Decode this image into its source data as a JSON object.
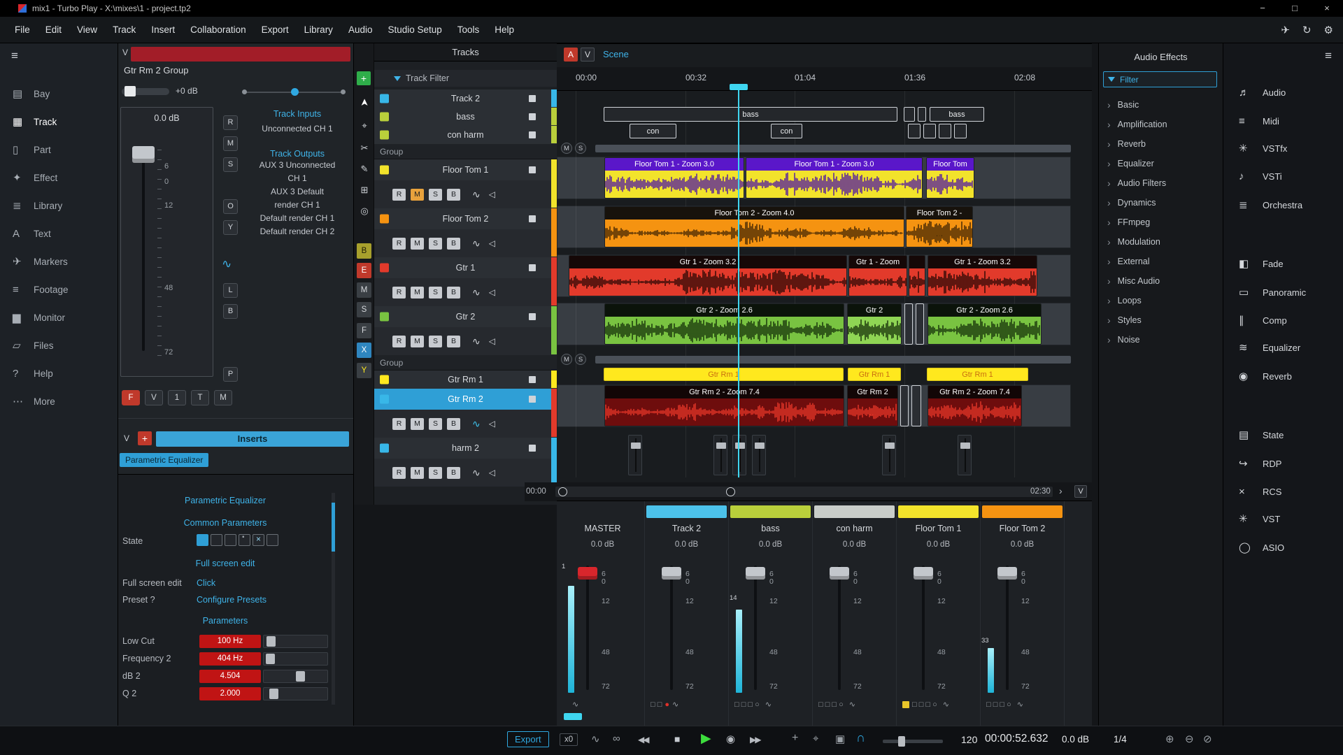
{
  "titlebar": {
    "title": "mix1 - Turbo Play - X:\\mixes\\1 - project.tp2",
    "minimize": "−",
    "maximize": "□",
    "close": "×"
  },
  "menubar": {
    "items": [
      "File",
      "Edit",
      "View",
      "Track",
      "Insert",
      "Collaboration",
      "Export",
      "Library",
      "Audio",
      "Studio Setup",
      "Tools",
      "Help"
    ],
    "right_icons": [
      {
        "glyph": "✈"
      },
      {
        "glyph": "↻"
      },
      {
        "glyph": "⚙"
      }
    ]
  },
  "nav": {
    "items": [
      {
        "label": "Bay",
        "glyph": "▤"
      },
      {
        "label": "Track",
        "glyph": "▦",
        "cls": "active"
      },
      {
        "label": "Part",
        "glyph": "▯"
      },
      {
        "label": "Effect",
        "glyph": "✦"
      },
      {
        "label": "Library",
        "glyph": "≣"
      },
      {
        "label": "Text",
        "glyph": "A"
      },
      {
        "label": "Markers",
        "glyph": "✈"
      },
      {
        "label": "Footage",
        "glyph": "≡"
      },
      {
        "label": "Monitor",
        "glyph": "▆"
      },
      {
        "label": "Files",
        "glyph": "▱"
      },
      {
        "label": "Help",
        "glyph": "?"
      },
      {
        "label": "More",
        "glyph": "⋯"
      }
    ]
  },
  "channel": {
    "header_button": "V",
    "group_label": "Gtr Rm 2 Group",
    "volume_label": "+0 dB",
    "fader_db": "0.0 dB",
    "fader_scale": [
      {
        "label": "6",
        "style": "top:78px"
      },
      {
        "label": "0",
        "style": "top:100px"
      },
      {
        "label": "12",
        "style": "top:134px"
      },
      {
        "label": "48",
        "style": "top:252px"
      },
      {
        "label": "72",
        "style": "top:344px"
      }
    ],
    "side_buttons": [
      {
        "label": "R",
        "style": "top:103px"
      },
      {
        "label": "M",
        "style": "top:133px"
      },
      {
        "label": "S",
        "style": "top:163px"
      },
      {
        "label": "O",
        "style": "top:223px"
      },
      {
        "label": "Y",
        "style": "top:253px"
      },
      {
        "label": "L",
        "style": "top:343px"
      },
      {
        "label": "B",
        "style": "top:373px"
      },
      {
        "label": "P",
        "style": "top:463px"
      }
    ],
    "lfo_glyph": "∿",
    "inputs_title": "Track Inputs",
    "inputs_value": "Unconnected CH 1",
    "outputs_title": "Track Outputs",
    "outputs_lines": [
      "AUX 3 Unconnected",
      "CH 1",
      "AUX 3 Default",
      "render CH 1",
      "Default render CH 1",
      "Default render CH 2"
    ],
    "bottom_buttons": [
      {
        "label": "F",
        "style": "background:#c0392b;border-color:#c0392b;color:#fff"
      },
      {
        "label": "V"
      },
      {
        "label": "1"
      },
      {
        "label": "T"
      },
      {
        "label": "M"
      }
    ],
    "inserts_v": "V",
    "inserts_add": "+",
    "inserts_label": "Inserts",
    "insert_chip": "Parametric Equalizer"
  },
  "eq": {
    "title": "Parametric Equalizer",
    "common_header": "Common Parameters",
    "state_label": "State",
    "state_boxes": [
      {
        "cls": "filled"
      },
      {
        "cls": "empty"
      },
      {
        "cls": "empty"
      },
      {
        "cls": "dot"
      },
      {
        "cls": "cross"
      },
      {
        "cls": "empty"
      }
    ],
    "fullscreen_link": "Full screen edit",
    "fullscreen_label": "Full screen edit",
    "fullscreen_value": "Click",
    "preset_label": "Preset ?",
    "preset_value": "Configure Presets",
    "params_header": "Parameters",
    "params": [
      {
        "label": "Low Cut",
        "value": "100 Hz",
        "handle_style": "left:4px"
      },
      {
        "label": "Frequency 2",
        "value": "404 Hz",
        "handle_style": "left:3px"
      },
      {
        "label": "dB 2",
        "value": "4.504",
        "handle_style": "left:46px"
      },
      {
        "label": "Q 2",
        "value": "2.000",
        "handle_style": "left:8px"
      }
    ]
  },
  "tools": {
    "add_label": "+",
    "icons": [
      {
        "glyph": "➤",
        "style": "top:76px",
        "cls": "pointer"
      },
      {
        "glyph": "⌖",
        "style": "top:110px"
      },
      {
        "glyph": "✂",
        "style": "top:142px"
      },
      {
        "glyph": "✎",
        "style": "top:172px"
      },
      {
        "glyph": "⊞",
        "style": "top:202px"
      },
      {
        "glyph": "◎",
        "style": "top:232px"
      }
    ],
    "letters": [
      {
        "label": "B",
        "style": "top:286px;background:#a8a02c;color:#1d1b08"
      },
      {
        "label": "E",
        "style": "top:314px;background:#c0392b;color:#fff"
      },
      {
        "label": "M",
        "style": "top:342px"
      },
      {
        "label": "S",
        "style": "top:370px"
      },
      {
        "label": "F",
        "style": "top:400px"
      },
      {
        "label": "X",
        "style": "top:428px;background:#2f86c0;color:#fff"
      },
      {
        "label": "Y",
        "style": "top:457px;color:#ffe81e"
      }
    ]
  },
  "tracks": {
    "header": "Tracks",
    "filter_label": "Track Filter",
    "row_buttons": [
      "R",
      "M",
      "S",
      "B"
    ],
    "wave_glyph": "∿",
    "speaker_glyph": "◁",
    "rows": [
      {
        "cls": "simple",
        "name": "Track 2",
        "swatch": "background:#38b7e8",
        "bar": "background:#38b7e8"
      },
      {
        "cls": "simple",
        "name": "bass",
        "swatch": "background:#b9cf3b",
        "bar": "background:#b9cf3b"
      },
      {
        "cls": "simple",
        "name": "con harm",
        "swatch": "background:#b9cf3b",
        "bar": "background:#b9cf3b"
      },
      {
        "cls": "group",
        "name": "Group"
      },
      {
        "cls": "full",
        "name": "Floor Tom 1",
        "swatch": "background:#f2e32b",
        "bar": "background:#f2e32b",
        "m_style": "background:#e8a23c;color:#222"
      },
      {
        "cls": "full",
        "name": "Floor Tom 2",
        "swatch": "background:#f59311",
        "bar": "background:#f59311"
      },
      {
        "cls": "full",
        "name": "Gtr 1",
        "swatch": "background:#e23a2b",
        "bar": "background:#e23a2b"
      },
      {
        "cls": "full",
        "name": "Gtr 2",
        "swatch": "background:#79c341",
        "bar": "background:#79c341"
      },
      {
        "cls": "group",
        "name": "Group"
      },
      {
        "cls": "simple",
        "name": "Gtr Rm 1",
        "swatch": "background:#ffe81e",
        "bar": "background:#ffe81e"
      },
      {
        "cls": "full sel",
        "name": "Gtr Rm 2",
        "swatch": "background:#38b7e8",
        "bar": "background:#e23a2b",
        "wave_style": "color:#3fc6f0"
      },
      {
        "cls": "full",
        "name": "harm 2",
        "swatch": "background:#38b7e8",
        "bar": "background:#38b7e8"
      }
    ]
  },
  "timeline": {
    "btn_a": "A",
    "btn_v": "V",
    "scene_label": "Scene",
    "ruler": [
      {
        "label": "00:00",
        "style": "left:27px"
      },
      {
        "label": "00:32",
        "style": "left:184px"
      },
      {
        "label": "01:04",
        "style": "left:340px"
      },
      {
        "label": "01:36",
        "style": "left:497px"
      },
      {
        "label": "02:08",
        "style": "left:654px"
      }
    ],
    "group_ms": [
      "M",
      "S"
    ],
    "row_bass": [
      {
        "label": "bass",
        "style": "left:67px;width:420px"
      },
      {
        "label": "",
        "style": "left:496px;width:16px"
      },
      {
        "label": "",
        "style": "left:516px;width:12px"
      },
      {
        "label": "bass",
        "style": "left:533px;width:78px"
      }
    ],
    "row_con": [
      {
        "label": "con",
        "style": "left:104px;width:67px"
      },
      {
        "label": "con",
        "style": "left:306px;width:45px"
      },
      {
        "label": "",
        "style": "left:502px;width:18px"
      },
      {
        "label": "",
        "style": "left:524px;width:18px"
      },
      {
        "label": "",
        "style": "left:546px;width:18px"
      },
      {
        "label": "",
        "style": "left:568px;width:18px"
      }
    ],
    "row_ft1": [
      {
        "label": "Floor Tom 1 - Zoom 3.0",
        "style": "left:67px;width:200px",
        "head_style": "background:#5a17c9",
        "body_style": "background:#f2e32b;color:#4b11a8"
      },
      {
        "label": "Floor Tom 1 - Zoom 3.0",
        "style": "left:269px;width:253px",
        "head_style": "background:#5a17c9",
        "body_style": "background:#f2e32b;color:#4b11a8"
      },
      {
        "label": "Floor Tom",
        "style": "left:527px;width:69px",
        "head_style": "background:#5a17c9",
        "body_style": "background:#f2e32b;color:#4b11a8",
        "dots": "..."
      }
    ],
    "row_ft2": [
      {
        "label": "Floor Tom 2 - Zoom 4.0",
        "style": "left:67px;width:429px",
        "head_style": "background:#17120c",
        "body_style": "background:#f59311;color:#3c2203"
      },
      {
        "label": "Floor Tom 2 -",
        "style": "left:498px;width:96px",
        "head_style": "background:#17120c",
        "body_style": "background:#f59311;color:#3c2203",
        "dots": "..."
      }
    ],
    "row_g1": [
      {
        "label": "Gtr 1 - Zoom 3.2",
        "style": "left:16px;width:398px",
        "head_style": "background:#150807",
        "body_style": "background:#e23a2b;color:#270704"
      },
      {
        "label": "Gtr 1 - Zoom",
        "style": "left:416px;width:84px",
        "head_style": "background:#150807",
        "body_style": "background:#e23a2b;color:#270704"
      },
      {
        "label": "",
        "style": "left:502px;width:24px",
        "head_style": "background:#150807",
        "body_style": "background:#e23a2b;color:#270704",
        "dots": "..."
      },
      {
        "label": "Gtr 1 - Zoom 3.2",
        "style": "left:529px;width:157px",
        "head_style": "background:#150807",
        "body_style": "background:#e23a2b;color:#270704"
      }
    ],
    "row_g2": [
      {
        "label": "Gtr 2 - Zoom 2.6",
        "style": "left:67px;width:343px",
        "head_style": "background:#0b130a",
        "body_style": "background:#79c341;color:#122c08"
      },
      {
        "label": "Gtr 2",
        "style": "left:414px;width:78px",
        "head_style": "background:#0b130a",
        "body_style": "background:#8fd554;color:#122c08"
      },
      {
        "label": "Gtr 2 - Zoom 2.6",
        "style": "left:529px;width:163px",
        "head_style": "background:#0b130a",
        "body_style": "background:#79c341;color:#122c08"
      }
    ],
    "g2_boxes": [
      {
        "style": "left:496px;width:12px"
      },
      {
        "style": "left:512px;width:12px"
      }
    ],
    "row_gr1": [
      {
        "label": "Gtr Rm 1",
        "style": "left:67px;width:343px"
      },
      {
        "label": "Gtr Rm 1",
        "style": "left:416px;width:76px"
      },
      {
        "label": "Gtr Rm 1",
        "style": "left:529px;width:145px"
      }
    ],
    "row_gr2": [
      {
        "label": "Gtr Rm 2 - Zoom 7.4",
        "style": "left:67px;width:343px",
        "head_style": "background:#120606",
        "body_style": "background:#6e0d0d;color:#e8372a"
      },
      {
        "label": "Gtr Rm 2",
        "style": "left:414px;width:73px",
        "head_style": "background:#120606",
        "body_style": "background:#6e0d0d;color:#e8372a",
        "dots": "..."
      },
      {
        "label": "Gtr Rm 2 - Zoom 7.4",
        "style": "left:529px;width:135px",
        "head_style": "background:#120606",
        "body_style": "background:#6e0d0d;color:#e8372a"
      }
    ],
    "gr2_boxes": [
      {
        "style": "left:490px;width:12px"
      },
      {
        "style": "left:506px;width:14px"
      }
    ],
    "autos": [
      {
        "style": "left:102px"
      },
      {
        "style": "left:224px"
      },
      {
        "style": "left:251px"
      },
      {
        "style": "left:279px"
      },
      {
        "style": "left:465px"
      },
      {
        "style": "left:573px"
      }
    ],
    "scrub_start": "00:00",
    "scrub_end": "02:30",
    "scrub_next": "›",
    "scrub_v": "V"
  },
  "mixer": {
    "scale": [
      "6",
      "0",
      "12",
      "48",
      "72"
    ],
    "channels": [
      {
        "name": "MASTER",
        "db": "0.0 dB",
        "style": "left:6px",
        "handle_style": "background:#d8262c",
        "meter_style": "display:block;height:153px",
        "meter_num": "1",
        "meter_num_style": "display:block;top:2px",
        "icons_l": "",
        "dot": "",
        "icons_r": "∿"
      },
      {
        "name": "Track 2",
        "db": "0.0 dB",
        "style": "left:126px",
        "head_style": "display:block;background:#4cc2ea",
        "icons_l": "□ □",
        "dot": "●",
        "dot_style": "color:#e0312a",
        "icons_r": "∿"
      },
      {
        "name": "bass",
        "db": "0.0 dB",
        "style": "left:246px",
        "head_style": "display:block;background:#b9cf3b",
        "meter_style": "display:block;height:119px",
        "meter_num": "14",
        "meter_num_style": "display:block;top:47px",
        "icons_l": "□ □ □ ○",
        "dot": "",
        "icons_r": "∿"
      },
      {
        "name": "con harm",
        "db": "0.0 dB",
        "style": "left:366px",
        "head_style": "display:block;background:#c9cdc9",
        "icons_l": "□ □ □ ○",
        "dot": "",
        "icons_r": "∿"
      },
      {
        "name": "Floor Tom 1",
        "db": "0.0 dB",
        "style": "left:486px",
        "head_style": "display:block;background:#f2e32b",
        "led_style": "display:inline-block;background:#e8c52a",
        "icons_l": "□ □ □ ○",
        "dot": "",
        "icons_r": "∿"
      },
      {
        "name": "Floor Tom 2",
        "db": "0.0 dB",
        "style": "left:606px",
        "head_style": "display:block;background:#f59311",
        "meter_style": "display:block;height:64px",
        "meter_num": "33",
        "meter_num_style": "display:block;top:108px",
        "icons_l": "□ □ □ ○",
        "dot": "",
        "icons_r": "∿"
      }
    ]
  },
  "effects": {
    "title": "Audio Effects",
    "filter_label": "Filter",
    "chevron": "›",
    "items": [
      "Basic",
      "Amplification",
      "Reverb",
      "Equalizer",
      "Audio Filters",
      "Dynamics",
      "FFmpeg",
      "Modulation",
      "External",
      "Misc Audio",
      "Loops",
      "Styles",
      "Noise"
    ]
  },
  "rightbar": {
    "items": [
      {
        "label": "Audio",
        "glyph": "♬",
        "style": "top:55px"
      },
      {
        "label": "Midi",
        "glyph": "≡",
        "style": "top:96px"
      },
      {
        "label": "VSTfx",
        "glyph": "✳",
        "style": "top:135px"
      },
      {
        "label": "VSTi",
        "glyph": "♪",
        "style": "top:175px"
      },
      {
        "label": "Orchestra",
        "glyph": "≣",
        "style": "top:216px"
      },
      {
        "label": "Fade",
        "glyph": "◧",
        "style": "top:300px"
      },
      {
        "label": "Panoramic",
        "glyph": "▭",
        "style": "top:341px"
      },
      {
        "label": "Comp",
        "glyph": "∥",
        "style": "top:381px"
      },
      {
        "label": "Equalizer",
        "glyph": "≋",
        "style": "top:420px"
      },
      {
        "label": "Reverb",
        "glyph": "◉",
        "style": "top:461px"
      },
      {
        "label": "State",
        "glyph": "▤",
        "style": "top:545px"
      },
      {
        "label": "RDP",
        "glyph": "↪",
        "style": "top:586px"
      },
      {
        "label": "RCS",
        "glyph": "×",
        "style": "top:626px"
      },
      {
        "label": "VST",
        "glyph": "✳",
        "style": "top:665px"
      },
      {
        "label": "ASIO",
        "glyph": "◯",
        "style": "top:706px"
      }
    ]
  },
  "transport": {
    "export_label": "Export",
    "x0_label": "x0",
    "wave_glyph": "∿",
    "loop_glyph": "∞",
    "rewind": "◀◀",
    "stop": "■",
    "play": "▶",
    "record": "◉",
    "forward": "▶▶",
    "add": "+",
    "marker": "⌖",
    "stopbox": "▣",
    "monitor": "∩",
    "tempo": "120",
    "time": "00:00:52.632",
    "db": "0.0 dB",
    "sig": "1/4",
    "zoom_in": "⊕",
    "zoom_out": "⊖",
    "zoom_fit": "⊘"
  }
}
